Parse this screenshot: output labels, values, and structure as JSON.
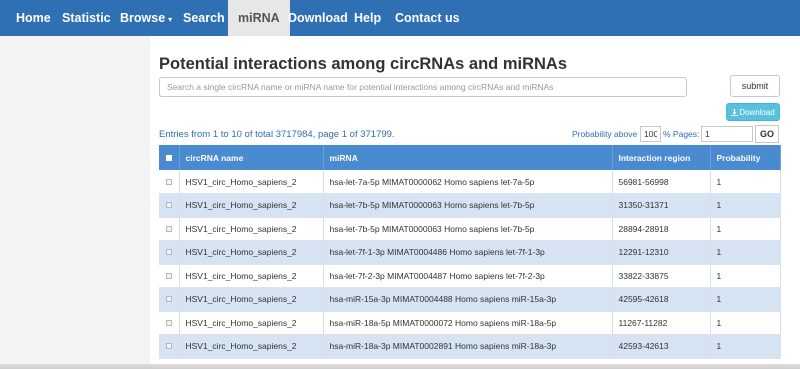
{
  "nav": {
    "items": [
      {
        "label": "Home"
      },
      {
        "label": "Statistic"
      },
      {
        "label": "Browse"
      },
      {
        "label": "Search"
      },
      {
        "label": "miRNA"
      },
      {
        "label": "Download"
      },
      {
        "label": "Help"
      },
      {
        "label": "Contact us"
      }
    ],
    "active": "miRNA"
  },
  "page": {
    "title": "Potential interactions among circRNAs and miRNAs",
    "search_placeholder": "Search a single circRNA name or miRNA name for potential interactions among circRNAs and miRNAs",
    "submit_label": "submit",
    "download_label": "Download",
    "entries_text": "Entries from 1 to 10 of total 3717984, page 1 of 371799.",
    "probability_label": "Probability above",
    "probability_value": "100",
    "percent_pages_label": "% Pages:",
    "pages_value": "1",
    "go_label": "GO"
  },
  "table": {
    "headers": [
      "circRNA name",
      "miRNA",
      "Interaction region",
      "Probability"
    ],
    "rows": [
      [
        "HSV1_circ_Homo_sapiens_2",
        "hsa-let-7a-5p MIMAT0000062 Homo sapiens let-7a-5p",
        "56981-56998",
        "1"
      ],
      [
        "HSV1_circ_Homo_sapiens_2",
        "hsa-let-7b-5p MIMAT0000063 Homo sapiens let-7b-5p",
        "31350-31371",
        "1"
      ],
      [
        "HSV1_circ_Homo_sapiens_2",
        "hsa-let-7b-5p MIMAT0000063 Homo sapiens let-7b-5p",
        "28894-28918",
        "1"
      ],
      [
        "HSV1_circ_Homo_sapiens_2",
        "hsa-let-7f-1-3p MIMAT0004486 Homo sapiens let-7f-1-3p",
        "12291-12310",
        "1"
      ],
      [
        "HSV1_circ_Homo_sapiens_2",
        "hsa-let-7f-2-3p MIMAT0004487 Homo sapiens let-7f-2-3p",
        "33822-33875",
        "1"
      ],
      [
        "HSV1_circ_Homo_sapiens_2",
        "hsa-miR-15a-3p MIMAT0004488 Homo sapiens miR-15a-3p",
        "42595-42618",
        "1"
      ],
      [
        "HSV1_circ_Homo_sapiens_2",
        "hsa-miR-18a-5p MIMAT0000072 Homo sapiens miR-18a-5p",
        "11267-11282",
        "1"
      ],
      [
        "HSV1_circ_Homo_sapiens_2",
        "hsa-miR-18a-3p MIMAT0002891 Homo sapiens miR-18a-3p",
        "42593-42613",
        "1"
      ]
    ]
  },
  "colors": {
    "navbar": "#2f6fb4",
    "table_header": "#4a8ad0",
    "row_alt": "#d6e3f2",
    "download_button": "#5bc0de"
  },
  "icons": {
    "download": "download-icon",
    "dropdown": "caret-down-icon",
    "checkbox": "checkbox-icon"
  }
}
